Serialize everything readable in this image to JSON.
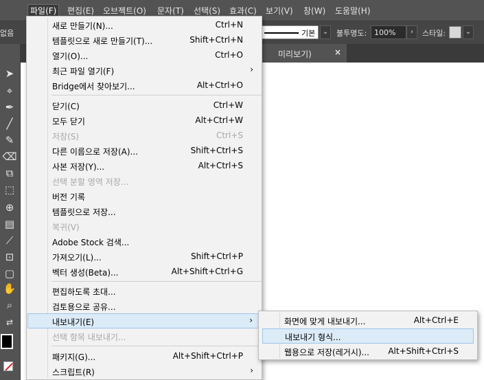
{
  "menubar": {
    "items": [
      "파일(F)",
      "편집(E)",
      "오브젝트(O)",
      "문자(T)",
      "선택(S)",
      "효과(C)",
      "보기(V)",
      "창(W)",
      "도움말(H)"
    ]
  },
  "controlbar": {
    "left_fragment": "없음",
    "stroke_style_label": "기본",
    "opacity_label": "불투명도:",
    "opacity_value": "100%",
    "style_label": "스타일:"
  },
  "tab": {
    "fragment_label": "미리보기)"
  },
  "file_menu": {
    "items": [
      {
        "label": "새로 만들기(N)...",
        "shortcut": "Ctrl+N"
      },
      {
        "label": "템플릿으로 새로 만들기(T)...",
        "shortcut": "Shift+Ctrl+N"
      },
      {
        "label": "열기(O)...",
        "shortcut": "Ctrl+O"
      },
      {
        "label": "최근 파일 열기(F)",
        "shortcut": ""
      },
      {
        "label": "Bridge에서 찾아보기...",
        "shortcut": "Alt+Ctrl+O"
      },
      {
        "label": "닫기(C)",
        "shortcut": "Ctrl+W"
      },
      {
        "label": "모두 닫기",
        "shortcut": "Alt+Ctrl+W"
      },
      {
        "label": "저장(S)",
        "shortcut": "Ctrl+S"
      },
      {
        "label": "다른 이름으로 저장(A)...",
        "shortcut": "Shift+Ctrl+S"
      },
      {
        "label": "사본 저장(Y)...",
        "shortcut": "Alt+Ctrl+S"
      },
      {
        "label": "선택 분할 영역 저장...",
        "shortcut": ""
      },
      {
        "label": "버전 기록",
        "shortcut": ""
      },
      {
        "label": "템플릿으로 저장...",
        "shortcut": ""
      },
      {
        "label": "복귀(V)",
        "shortcut": ""
      },
      {
        "label": "Adobe Stock 검색...",
        "shortcut": ""
      },
      {
        "label": "가져오기(L)...",
        "shortcut": "Shift+Ctrl+P"
      },
      {
        "label": "벡터 생성(Beta)...",
        "shortcut": "Alt+Shift+Ctrl+G"
      },
      {
        "label": "편집하도록 초대...",
        "shortcut": ""
      },
      {
        "label": "검토용으로 공유...",
        "shortcut": ""
      },
      {
        "label": "내보내기(E)",
        "shortcut": ""
      },
      {
        "label": "선택 항목 내보내기...",
        "shortcut": ""
      },
      {
        "label": "패키지(G)...",
        "shortcut": "Alt+Shift+Ctrl+P"
      },
      {
        "label": "스크립트(R)",
        "shortcut": ""
      }
    ]
  },
  "export_submenu": {
    "items": [
      {
        "label": "화면에 맞게 내보내기...",
        "shortcut": "Alt+Ctrl+E"
      },
      {
        "label": "내보내기 형식...",
        "shortcut": ""
      },
      {
        "label": "웹용으로 저장(레거시)...",
        "shortcut": "Alt+Shift+Ctrl+S"
      }
    ]
  },
  "icons": {
    "submenu_arrow": "chevron-right-icon",
    "tab_close": "close-icon",
    "dropdown": "chevron-down-icon"
  },
  "colors": {
    "menu_bg": "#f2f2f2",
    "highlight_bg": "#dcebf8",
    "highlight_border": "#9cc4ea",
    "disabled_text": "#a6a6a6",
    "chrome_dark": "#535353"
  }
}
